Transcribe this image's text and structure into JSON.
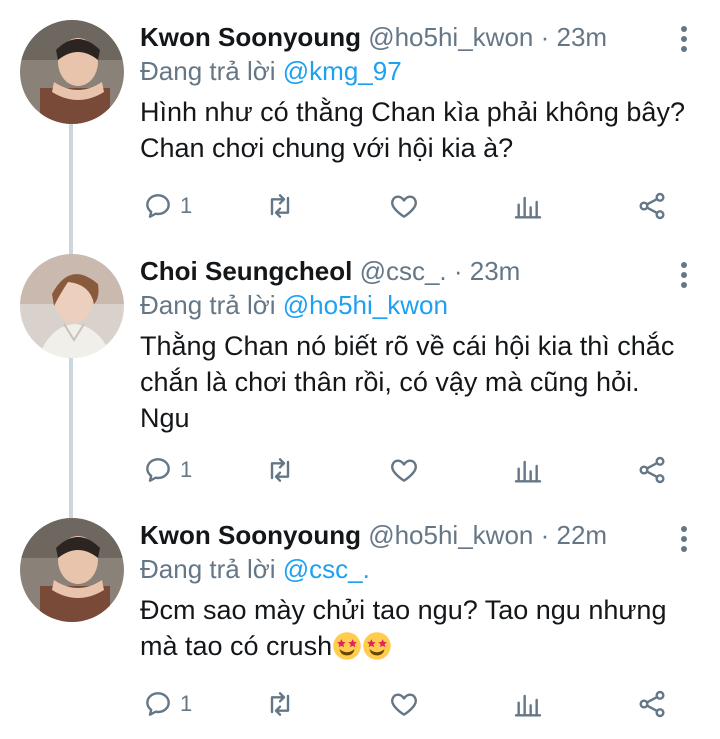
{
  "tweets": [
    {
      "name": "Kwon Soonyoung",
      "handle": "@ho5hi_kwon",
      "time": "23m",
      "replying_prefix": "Đang trả lời ",
      "replying_to": "@kmg_97",
      "text_lines": [
        "Hình như có thằng Chan kìa phải không bây?",
        "Chan chơi chung với hội kia à?"
      ],
      "reply_count": "1"
    },
    {
      "name": "Choi Seungcheol",
      "handle": "@csc_.",
      "time": "23m",
      "replying_prefix": "Đang trả lời ",
      "replying_to": "@ho5hi_kwon",
      "text_lines": [
        "Thằng Chan nó biết rõ về cái hội kia thì chắc",
        "chắn là chơi thân rồi, có vậy mà cũng hỏi.",
        "Ngu"
      ],
      "reply_count": "1"
    },
    {
      "name": "Kwon Soonyoung",
      "handle": "@ho5hi_kwon",
      "time": "22m",
      "replying_prefix": "Đang trả lời ",
      "replying_to": "@csc_.",
      "text_lines": [
        "Đcm sao mày chửi tao ngu? Tao ngu nhưng",
        "mà tao có crush"
      ],
      "reply_count": "1"
    }
  ],
  "separator": " · ",
  "icons": {
    "reply": "comment-icon",
    "retweet": "retweet-icon",
    "like": "heart-icon",
    "analytics": "analytics-icon",
    "share": "share-icon",
    "menu": "more-vertical-icon",
    "emoji": "star-struck-emoji"
  },
  "colors": {
    "text": "#14171a",
    "secondary": "#657786",
    "link": "#1da1f2",
    "thread_line": "#ccd6dd"
  }
}
